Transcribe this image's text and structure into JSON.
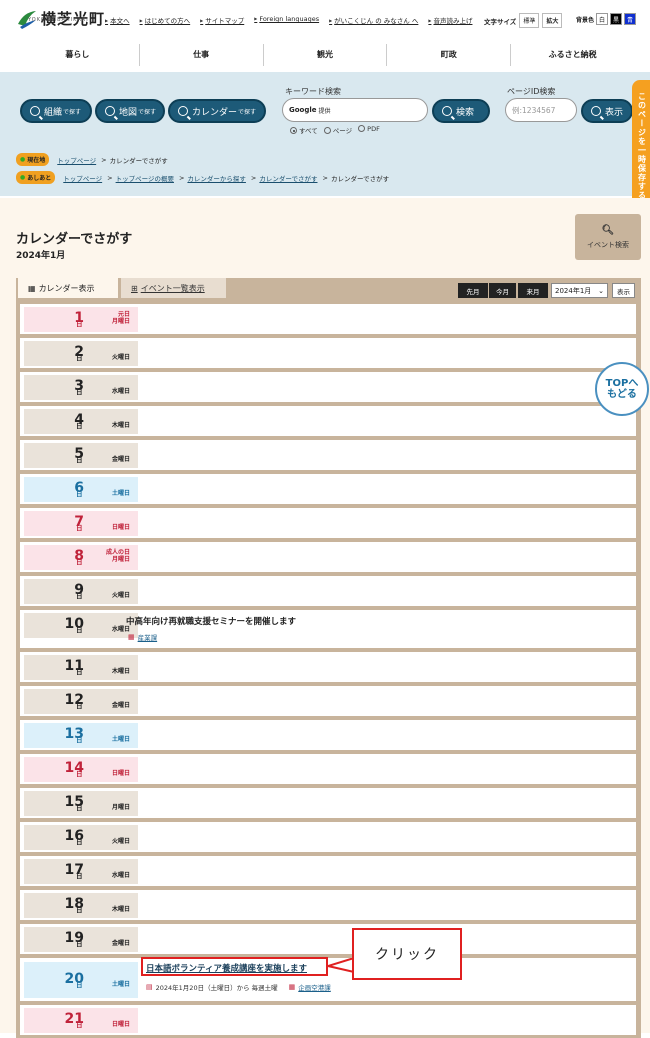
{
  "site": {
    "logo_text": "横芝光町",
    "logo_sub": "YOKOSHIBAHIKARI",
    "top_links": [
      "本文へ",
      "はじめての方へ",
      "サイトマップ",
      "Foreign languages",
      "がいこくじん の みなさん へ",
      "音声読み上げ"
    ],
    "font_size_label": "文字サイズ",
    "font_size_standard": "標準",
    "font_size_large": "拡大",
    "bg_color_label": "背景色",
    "bg_white": "白",
    "bg_black": "黒",
    "bg_blue": "青"
  },
  "gnav": [
    "暮らし",
    "仕事",
    "観光",
    "町政",
    "ふるさと納税"
  ],
  "search": {
    "org_button": "組織",
    "org_button_small": "で探す",
    "map_button": "地図",
    "map_button_small": "で探す",
    "cal_button": "カレンダー",
    "cal_button_small": "で探す",
    "keyword_label": "キーワード検索",
    "google_label": "Google",
    "google_sub": "提供",
    "search_button": "検索",
    "radio_all": "すべて",
    "radio_page": "ページ",
    "radio_pdf": "PDF",
    "pageid_label": "ページID検索",
    "pageid_placeholder": "例:1234567",
    "show_button": "表示"
  },
  "breadcrumb": {
    "current_tag": "現在地",
    "current_path": [
      "トップページ"
    ],
    "current_page": "カレンダーでさがす",
    "history_tag": "あしあと",
    "history_path": [
      "トップページ",
      "トップページの概要",
      "カレンダーから探す",
      "カレンダーでさがす"
    ],
    "history_page": "カレンダーでさがす"
  },
  "side_tab": "このページを一時保存する",
  "page": {
    "title": "カレンダーでさがす",
    "subtitle": "2024年1月",
    "event_search": "イベント検索"
  },
  "calendar": {
    "tab_calendar": "カレンダー表示",
    "tab_list": "イベント一覧表示",
    "prev": "先月",
    "this": "今月",
    "next": "来月",
    "month_value": "2024年1月",
    "show": "表示",
    "nichi": "日",
    "days": [
      {
        "num": "1",
        "wd": "月曜日",
        "hol": "元日",
        "type": "sun"
      },
      {
        "num": "2",
        "wd": "火曜日",
        "type": "wk"
      },
      {
        "num": "3",
        "wd": "水曜日",
        "type": "wk"
      },
      {
        "num": "4",
        "wd": "木曜日",
        "type": "wk"
      },
      {
        "num": "5",
        "wd": "金曜日",
        "type": "wk"
      },
      {
        "num": "6",
        "wd": "土曜日",
        "type": "sat"
      },
      {
        "num": "7",
        "wd": "日曜日",
        "type": "sun"
      },
      {
        "num": "8",
        "wd": "月曜日",
        "hol": "成人の日",
        "type": "sun"
      },
      {
        "num": "9",
        "wd": "火曜日",
        "type": "wk"
      },
      {
        "num": "10",
        "wd": "水曜日",
        "type": "wk"
      },
      {
        "num": "11",
        "wd": "木曜日",
        "type": "wk"
      },
      {
        "num": "12",
        "wd": "金曜日",
        "type": "wk"
      },
      {
        "num": "13",
        "wd": "土曜日",
        "type": "sat"
      },
      {
        "num": "14",
        "wd": "日曜日",
        "type": "sun"
      },
      {
        "num": "15",
        "wd": "月曜日",
        "type": "wk"
      },
      {
        "num": "16",
        "wd": "火曜日",
        "type": "wk"
      },
      {
        "num": "17",
        "wd": "水曜日",
        "type": "wk"
      },
      {
        "num": "18",
        "wd": "木曜日",
        "type": "wk"
      },
      {
        "num": "19",
        "wd": "金曜日",
        "type": "wk"
      },
      {
        "num": "20",
        "wd": "土曜日",
        "type": "sat"
      },
      {
        "num": "21",
        "wd": "日曜日",
        "type": "sun"
      }
    ],
    "event_10_title": "中高年向け再就職支援セミナーを開催します",
    "event_10_dept": "産業課",
    "event_20_title": "日本語ボランティア養成講座を実施します",
    "event_20_date": "2024年1月20日（土曜日）から 毎週土曜",
    "event_20_dept": "企画空港課"
  },
  "callout": "クリック",
  "totop": {
    "line1": "TOPへ",
    "line2": "もどる"
  }
}
